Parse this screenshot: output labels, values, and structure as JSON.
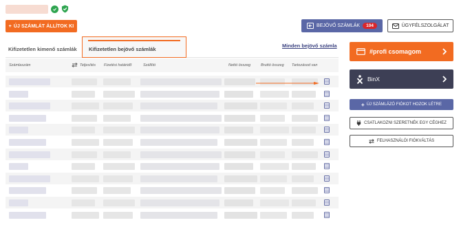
{
  "header": {
    "account_icon": "check-circle",
    "shield_icon": "shield-check"
  },
  "toolbar": {
    "new_invoice_label": "ÚJ SZÁMLÁT ÁLLÍTOK KI",
    "incoming_label": "BEJÖVŐ SZÁMLÁK",
    "incoming_count": "104",
    "support_label": "ÜGYFÉLSZOLGÁLAT"
  },
  "tabs": {
    "outgoing": "Kifizetetlen kimenő számlák",
    "incoming": "Kifizetetlen bejövő számlák",
    "all_link": "Minden bejövő számla"
  },
  "table": {
    "columns": [
      "Számlaszám",
      "Teljesítés",
      "Fizetési határidő",
      "Szállító",
      "Nettó összeg",
      "Bruttó összeg",
      "Tartozásod van"
    ],
    "row_count_visible": 12
  },
  "sidebar": {
    "profi_label": "#profi csomagom",
    "binx_label": "BinX",
    "new_account_label": "ÚJ SZÁMLÁZÓ FIÓKOT HOZOK LÉTRE",
    "join_company_label": "CSATLAKOZNI SZERETNÉK EGY CÉGHEZ",
    "switch_account_label": "FELHASZNÁLÓI FIÓKVÁLTÁS"
  },
  "colors": {
    "accent": "#f26b21",
    "primary": "#5a67a6",
    "dark_card": "#3d3f55",
    "badge": "#d9262b"
  }
}
